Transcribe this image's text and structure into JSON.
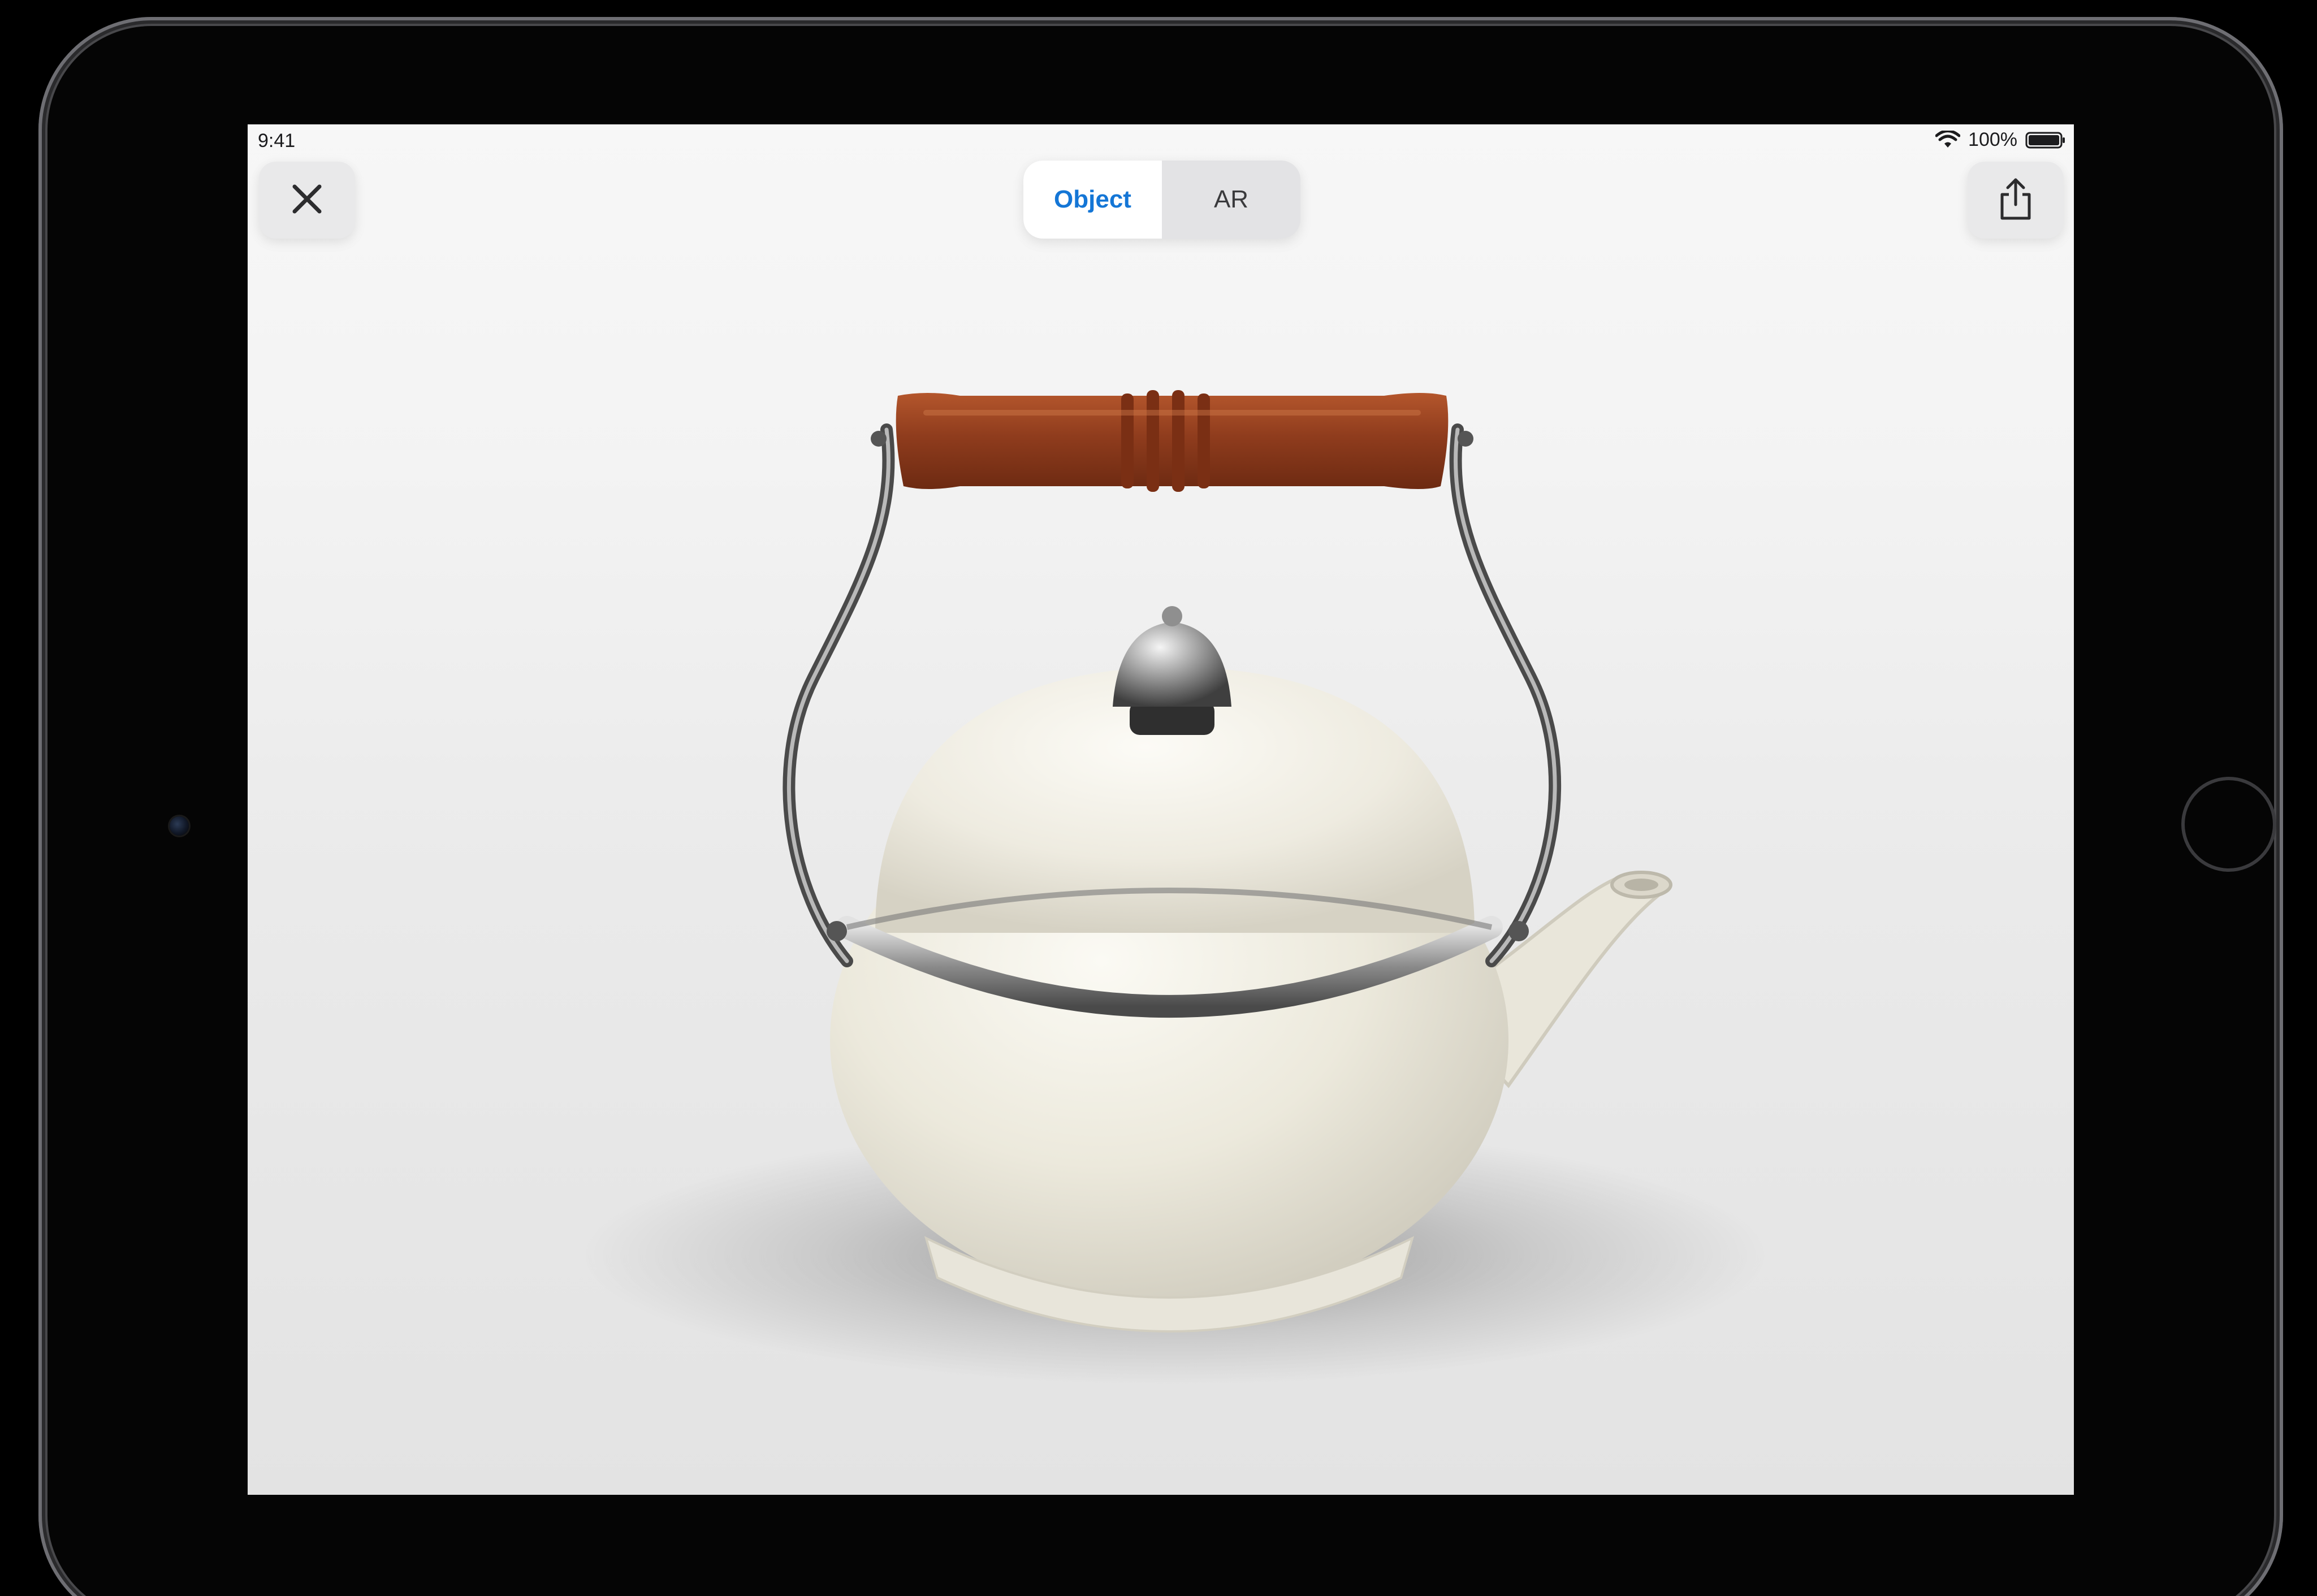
{
  "status_bar": {
    "time": "9:41",
    "battery_percent": "100%",
    "wifi_icon": "wifi-icon",
    "battery_icon": "battery-icon",
    "battery_level": 1.0
  },
  "toolbar": {
    "close_icon": "close-icon",
    "share_icon": "share-icon",
    "segments": [
      {
        "label": "Object",
        "selected": true
      },
      {
        "label": "AR",
        "selected": false
      }
    ]
  },
  "viewer": {
    "object_icon": "kettle-model"
  },
  "colors": {
    "accent": "#1476d6",
    "handle_wood": "#8e3c1e",
    "enamel": "#f0ede2",
    "metal": "#6f6f6f"
  }
}
